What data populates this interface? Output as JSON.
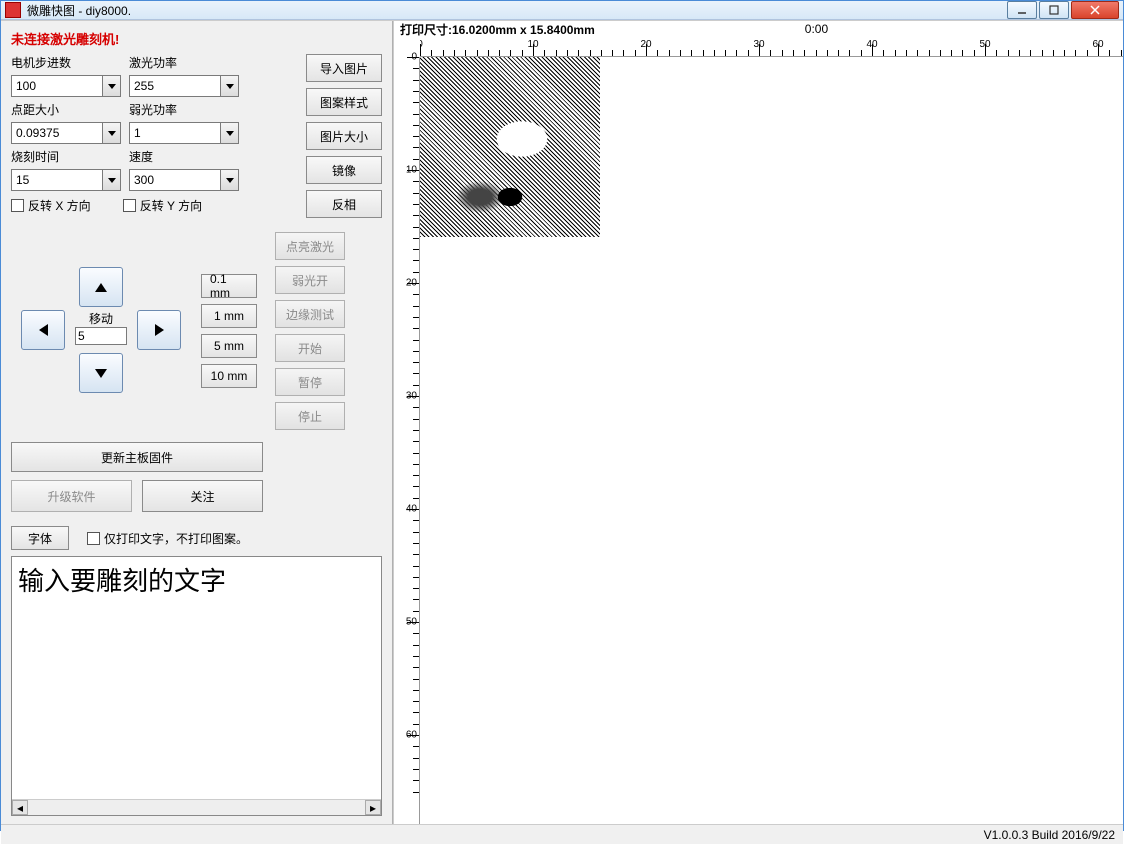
{
  "window": {
    "title": "微雕快图 - diy8000."
  },
  "left": {
    "warning": "未连接激光雕刻机!",
    "params": {
      "motor_steps_label": "电机步进数",
      "motor_steps_value": "100",
      "laser_power_label": "激光功率",
      "laser_power_value": "255",
      "dot_dist_label": "点距大小",
      "dot_dist_value": "0.09375",
      "weak_power_label": "弱光功率",
      "weak_power_value": "1",
      "burn_time_label": "烧刻时间",
      "burn_time_value": "15",
      "speed_label": "速度",
      "speed_value": "300"
    },
    "flipx_label": "反转 X 方向",
    "flipy_label": "反转 Y 方向",
    "move_label": "移动",
    "move_value": "5",
    "step_sizes": [
      "0.1 mm",
      "1 mm",
      "5 mm",
      "10 mm"
    ],
    "update_firmware": "更新主板固件",
    "upgrade_software": "升级软件",
    "follow": "关注",
    "font_button": "字体",
    "print_text_only": "仅打印文字，不打印图案。",
    "text_placeholder": "输入要雕刻的文字"
  },
  "image_buttons": {
    "import_image": "导入图片",
    "pattern_style": "图案样式",
    "image_size": "图片大小",
    "mirror": "镜像",
    "invert": "反相"
  },
  "laser_buttons": {
    "laser_on": "点亮激光",
    "weak_on": "弱光开",
    "edge_test": "边缘测试",
    "start": "开始",
    "pause": "暂停",
    "stop": "停止"
  },
  "canvas": {
    "print_size_label": "打印尺寸:16.0200mm x 15.8400mm",
    "timer": "0:00",
    "ruler_ticks": [
      "0",
      "10",
      "20",
      "30",
      "40",
      "50",
      "60"
    ]
  },
  "status": {
    "version": "V1.0.0.3 Build 2016/9/22"
  }
}
